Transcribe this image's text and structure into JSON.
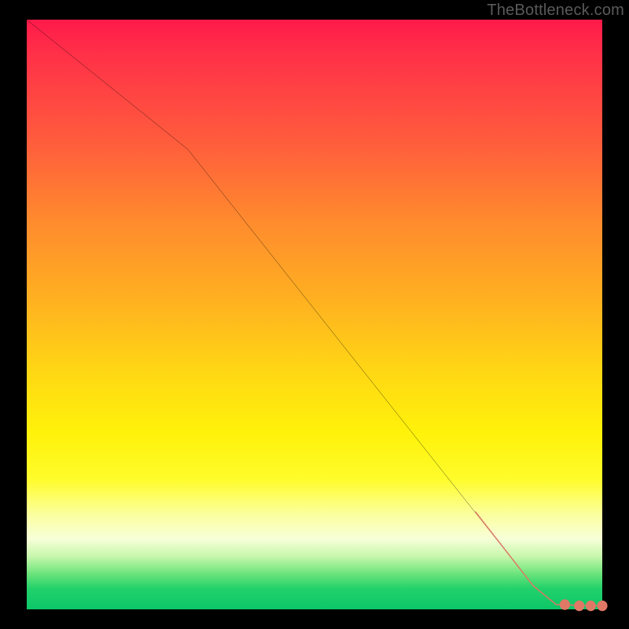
{
  "watermark": "TheBottleneck.com",
  "chart_data": {
    "type": "line",
    "title": "",
    "xlabel": "",
    "ylabel": "",
    "xlim": [
      0,
      100
    ],
    "ylim": [
      0,
      100
    ],
    "grid": false,
    "legend": false,
    "curve": [
      {
        "x": 0,
        "y": 100
      },
      {
        "x": 28,
        "y": 78
      },
      {
        "x": 88,
        "y": 4
      },
      {
        "x": 92,
        "y": 0.8
      },
      {
        "x": 100,
        "y": 0.6
      }
    ],
    "dashed_segments": [
      {
        "x1": 78,
        "y1": 16.5,
        "x2": 88,
        "y2": 4.0
      },
      {
        "x1": 88,
        "y1": 4.0,
        "x2": 92,
        "y2": 0.8
      },
      {
        "x1": 92,
        "y1": 0.8,
        "x2": 100,
        "y2": 0.6
      }
    ],
    "dash_color": "#e07866",
    "line_color": "#000000",
    "gradient_stops": [
      {
        "pos": 0.0,
        "color": "#ff1a4a"
      },
      {
        "pos": 0.5,
        "color": "#ffb220"
      },
      {
        "pos": 0.72,
        "color": "#fff20a"
      },
      {
        "pos": 0.88,
        "color": "#f7ffd8"
      },
      {
        "pos": 1.0,
        "color": "#0cc768"
      }
    ]
  }
}
